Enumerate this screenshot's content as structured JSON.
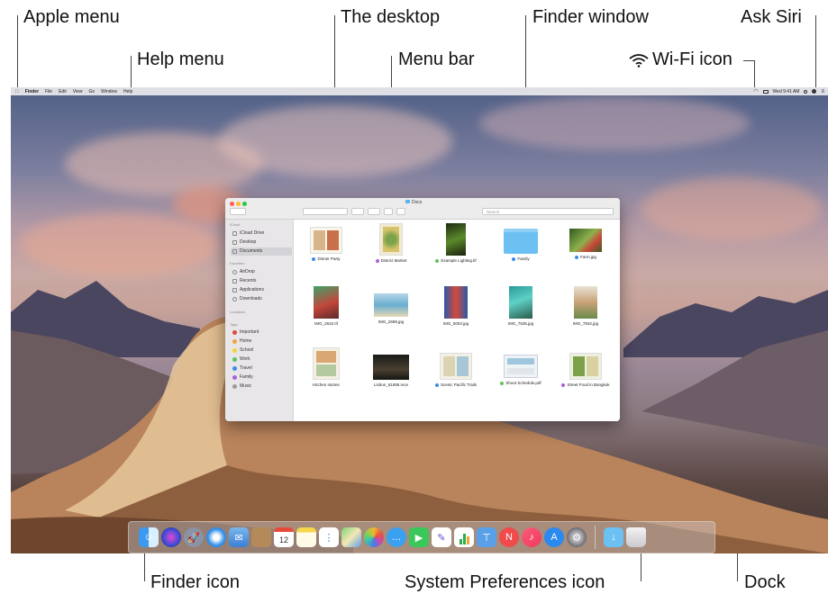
{
  "callouts": {
    "apple_menu": "Apple menu",
    "help_menu": "Help menu",
    "the_desktop": "The desktop",
    "menu_bar": "Menu bar",
    "finder_window": "Finder window",
    "wifi_icon": "Wi-Fi icon",
    "ask_siri": "Ask Siri",
    "finder_icon": "Finder icon",
    "system_preferences_icon": "System Preferences icon",
    "dock": "Dock"
  },
  "menubar": {
    "apple_glyph": "",
    "items": [
      "Finder",
      "File",
      "Edit",
      "View",
      "Go",
      "Window",
      "Help"
    ],
    "clock": "Wed 9:41 AM"
  },
  "finder": {
    "title": "Docs",
    "search_placeholder": "Search",
    "sidebar": {
      "icloud_header": "iCloud",
      "icloud_items": [
        "iCloud Drive",
        "Desktop",
        "Documents"
      ],
      "favorites_header": "Favorites",
      "favorites_items": [
        "AirDrop",
        "Recents",
        "Applications",
        "Downloads"
      ],
      "locations_header": "Locations",
      "tags_header": "Tags",
      "tags": [
        {
          "label": "Important",
          "color": "#e0463d"
        },
        {
          "label": "Home",
          "color": "#f2a33a"
        },
        {
          "label": "School",
          "color": "#f6d23c"
        },
        {
          "label": "Work",
          "color": "#5cc55a"
        },
        {
          "label": "Travel",
          "color": "#3f8ae8"
        },
        {
          "label": "Family",
          "color": "#a863d8"
        },
        {
          "label": "Music",
          "color": "#9a9a9a"
        }
      ]
    },
    "files": [
      {
        "name": "Dinner Party",
        "tag": "#3f8ae8"
      },
      {
        "name": "District Market",
        "tag": "#a863d8"
      },
      {
        "name": "Example Lighting.tif",
        "tag": "#5cc55a"
      },
      {
        "name": "Family",
        "tag": "#3f8ae8"
      },
      {
        "name": "Farm.jpg",
        "tag": "#3f8ae8"
      },
      {
        "name": "IMG_2632.tif",
        "tag": ""
      },
      {
        "name": "IMG_2689.jpg",
        "tag": ""
      },
      {
        "name": "IMG_5003.jpg",
        "tag": ""
      },
      {
        "name": "IMG_7635.jpg",
        "tag": ""
      },
      {
        "name": "IMG_7932.jpg",
        "tag": ""
      },
      {
        "name": "Kitchen stories",
        "tag": ""
      },
      {
        "name": "Lisbon_61695.mov",
        "tag": ""
      },
      {
        "name": "Scenic Pacific Trails",
        "tag": "#3f8ae8"
      },
      {
        "name": "Shoot Schedule.pdf",
        "tag": "#5cc55a"
      },
      {
        "name": "Street Food in Bangkok",
        "tag": "#a863d8"
      }
    ]
  },
  "dock_icons": [
    "finder-icon",
    "siri-icon",
    "launchpad-icon",
    "safari-icon",
    "mail-icon",
    "contacts-icon",
    "calendar-icon",
    "notes-icon",
    "reminders-icon",
    "maps-icon",
    "photos-icon",
    "messages-icon",
    "facetime-icon",
    "freeform-icon",
    "numbers-icon",
    "keynote-icon",
    "news-icon",
    "music-icon",
    "app-store-icon",
    "system-preferences-icon",
    "downloads-folder-icon",
    "trash-icon"
  ],
  "calendar_day": "12",
  "colors": {
    "screen_sky": "#7d7f9f",
    "dune": "#c08a62",
    "finder_sidebar": "#e8e6e8",
    "dock": "#c8c3c8"
  }
}
